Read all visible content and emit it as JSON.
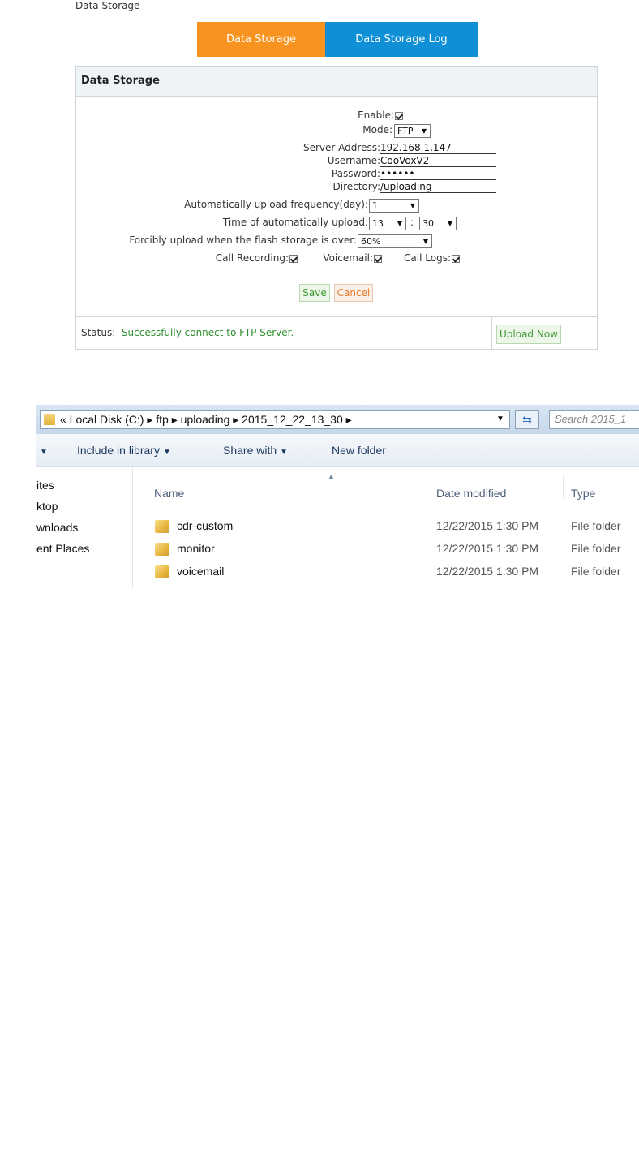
{
  "page": {
    "caption": "Data Storage"
  },
  "tabs": {
    "active": "Data Storage",
    "other": "Data Storage Log"
  },
  "panel": {
    "title": "Data Storage"
  },
  "form": {
    "enable_label": "Enable:",
    "enable_checked": true,
    "mode_label": "Mode:",
    "mode_value": "FTP",
    "server_label": "Server Address:",
    "server_value": "192.168.1.147",
    "username_label": "Username:",
    "username_value": "CooVoxV2",
    "password_label": "Password:",
    "password_value": "••••••",
    "directory_label": "Directory:",
    "directory_value": "/uploading",
    "frequency_label": "Automatically upload frequency(day):",
    "frequency_value": "1",
    "time_label": "Time of automatically upload:",
    "time_hour": "13",
    "time_sep": ":",
    "time_minute": "30",
    "forcibly_label": "Forcibly upload when the flash storage is over:",
    "forcibly_value": "60%",
    "call_recording_label": "Call Recording:",
    "voicemail_label": "Voicemail:",
    "call_logs_label": "Call Logs:",
    "save_label": "Save",
    "cancel_label": "Cancel"
  },
  "status": {
    "label": "Status:",
    "value": "Successfully connect to FTP Server.",
    "upload_now_label": "Upload Now"
  },
  "explorer": {
    "address": "« Local Disk (C:) ▸ ftp ▸ uploading ▸ 2015_12_22_13_30 ▸",
    "search_placeholder": "Search 2015_1",
    "toolbar": {
      "include_label": "Include in library",
      "share_label": "Share with",
      "new_folder_label": "New folder"
    },
    "nav": [
      "ites",
      "ktop",
      "wnloads",
      "ent Places"
    ],
    "columns": {
      "name": "Name",
      "date": "Date modified",
      "type": "Type"
    },
    "files": [
      {
        "name": "cdr-custom",
        "date": "12/22/2015 1:30 PM",
        "type": "File folder"
      },
      {
        "name": "monitor",
        "date": "12/22/2015 1:30 PM",
        "type": "File folder"
      },
      {
        "name": "voicemail",
        "date": "12/22/2015 1:30 PM",
        "type": "File folder"
      }
    ]
  }
}
